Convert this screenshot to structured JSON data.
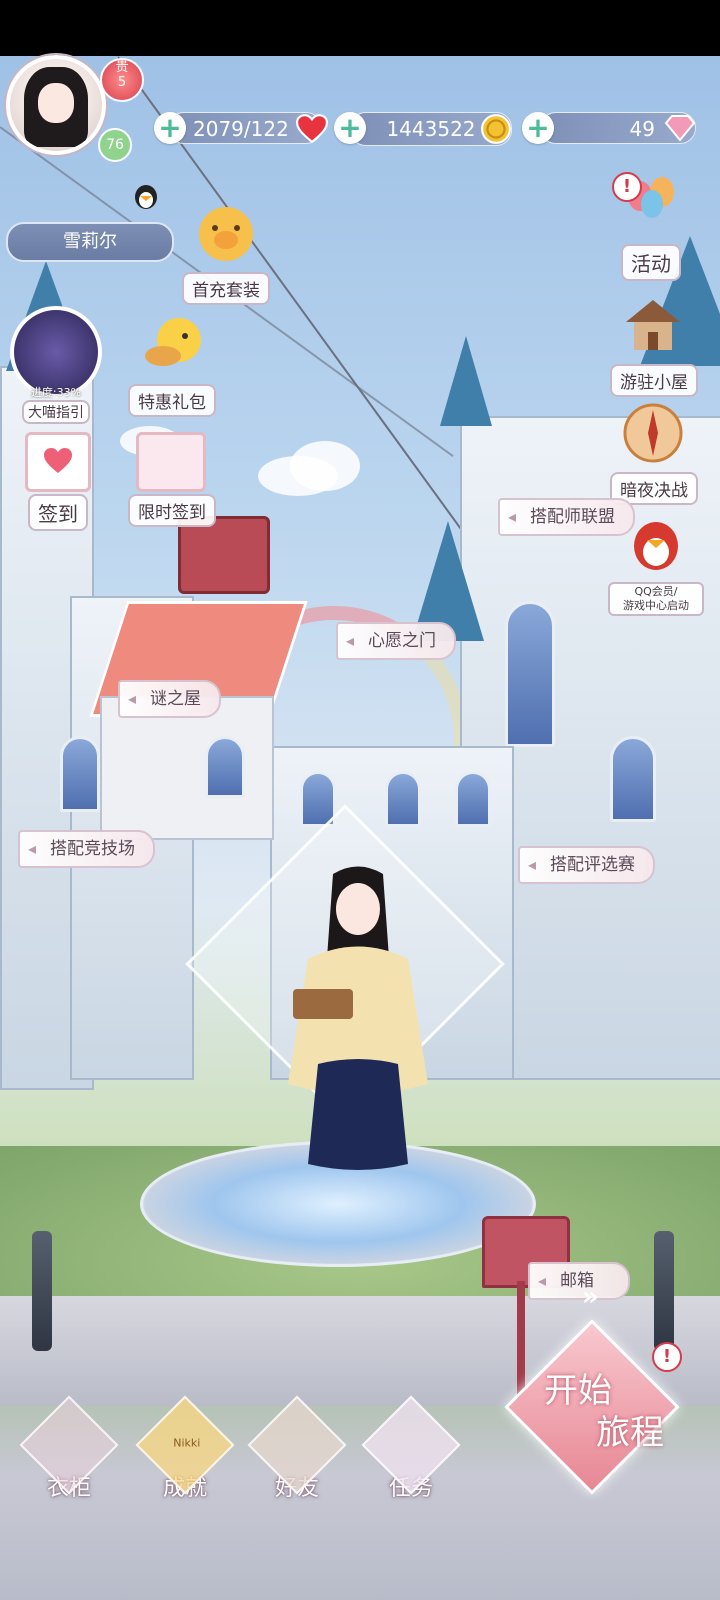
{
  "colors": {
    "accent": "#d43b4b",
    "hud_bar": "#7d8fb4",
    "plus": "#4dbb9a",
    "sign_text": "#5b4a58"
  },
  "profile": {
    "name": "雪莉尔",
    "vip_label": "贵",
    "vip_level": "5",
    "level": "76"
  },
  "resources": [
    {
      "value": "2079/122",
      "icon": "heart-icon"
    },
    {
      "value": "1443522",
      "icon": "gold-coin-icon"
    },
    {
      "value": "49",
      "icon": "diamond-icon"
    }
  ],
  "left_menu": {
    "first_charge": "首充套装",
    "deal_pack": "特惠礼包",
    "guide_progress": "进度:33%",
    "guide": "大喵指引",
    "checkin": "签到",
    "limited_checkin": "限时签到"
  },
  "right_menu": {
    "events": "活动",
    "cabin": "游驻小屋",
    "night_battle": "暗夜决战",
    "qq_line1": "QQ会员/",
    "qq_line2": "游戏中心启动"
  },
  "scene_signs": {
    "stylist_league": "搭配师联盟",
    "wish_gate": "心愿之门",
    "mystery_house": "谜之屋",
    "arena": "搭配竞技场",
    "selection": "搭配评选赛",
    "mail": "邮箱"
  },
  "bottom_nav": {
    "wardrobe": "衣柜",
    "achievement": "成就",
    "achievement_badge": "Nikki",
    "friends": "好友",
    "tasks": "任务"
  },
  "start": {
    "line1": "开始",
    "line2": "旅程"
  }
}
